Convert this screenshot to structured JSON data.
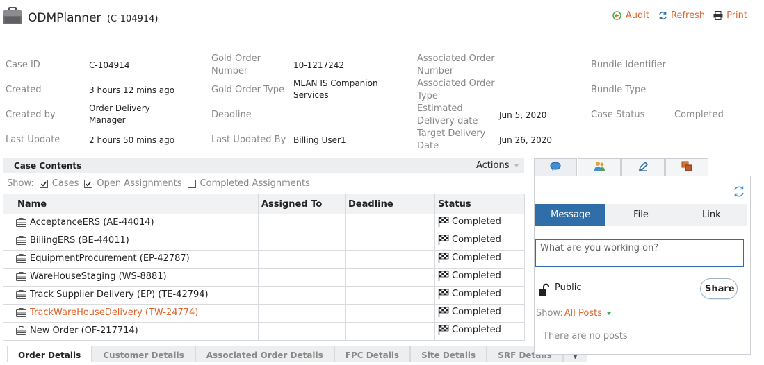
{
  "header": {
    "title": "ODMPlanner",
    "case_ref": "(C-104914)",
    "actions": [
      {
        "label": "Audit",
        "icon": "audit-icon"
      },
      {
        "label": "Refresh",
        "icon": "refresh-icon"
      },
      {
        "label": "Print",
        "icon": "print-icon"
      }
    ]
  },
  "summary": {
    "col1": [
      {
        "label": "Case ID",
        "value": "C-104914"
      },
      {
        "label": "Created",
        "value": "3 hours 12 mins ago"
      },
      {
        "label": "Created by",
        "value": "Order Delivery Manager"
      },
      {
        "label": "Last Update",
        "value": "2 hours 50 mins ago"
      }
    ],
    "col2": [
      {
        "label": "Gold Order Number",
        "value": "10-1217242"
      },
      {
        "label": "Gold Order Type",
        "value": "MLAN IS Companion Services"
      },
      {
        "label": "Deadline",
        "value": ""
      },
      {
        "label": "Last Updated By",
        "value": "Billing User1"
      }
    ],
    "col3": [
      {
        "label": "Associated Order Number",
        "value": ""
      },
      {
        "label": "Associated Order Type",
        "value": ""
      },
      {
        "label": "Estimated Delivery date",
        "value": "Jun 5, 2020"
      },
      {
        "label": "Target Delivery Date",
        "value": "Jun 26, 2020"
      }
    ],
    "col4": [
      {
        "label": "Bundle Identifier",
        "value": ""
      },
      {
        "label": "Bundle Type",
        "value": ""
      },
      {
        "label": "Case Status",
        "value": "Completed"
      },
      {
        "label": "",
        "value": ""
      }
    ]
  },
  "case_contents": {
    "title": "Case Contents",
    "actions_label": "Actions",
    "show_label": "Show:",
    "filters": [
      {
        "label": "Cases",
        "checked": true
      },
      {
        "label": "Open Assignments",
        "checked": true
      },
      {
        "label": "Completed Assignments",
        "checked": false
      }
    ],
    "columns": [
      "Name",
      "Assigned To",
      "Deadline",
      "Status"
    ],
    "rows": [
      {
        "name": "AcceptanceERS (AE-44014)",
        "assigned": "",
        "deadline": "",
        "status": "Completed"
      },
      {
        "name": "BillingERS (BE-44011)",
        "assigned": "",
        "deadline": "",
        "status": "Completed"
      },
      {
        "name": "EquipmentProcurement (EP-42787)",
        "assigned": "",
        "deadline": "",
        "status": "Completed"
      },
      {
        "name": "WareHouseStaging (WS-8881)",
        "assigned": "",
        "deadline": "",
        "status": "Completed"
      },
      {
        "name": "Track Supplier Delivery (EP) (TE-42794)",
        "assigned": "",
        "deadline": "",
        "status": "Completed"
      },
      {
        "name": "TrackWareHouseDelivery (TW-24774)",
        "assigned": "",
        "deadline": "",
        "status": "Completed",
        "highlight": true
      },
      {
        "name": "New Order (OF-217714)",
        "assigned": "",
        "deadline": "",
        "status": "Completed"
      }
    ]
  },
  "bottom_tabs": [
    "Order Details",
    "Customer Details",
    "Associated Order Details",
    "FPC Details",
    "Site Details",
    "SRF Details"
  ],
  "side_panel": {
    "tab_icons": [
      "chat-bubble-icon",
      "users-icon",
      "pencil-icon",
      "documents-icon"
    ],
    "post_types": [
      "Message",
      "File",
      "Link"
    ],
    "input_placeholder": "What are you working on?",
    "visibility": "Public",
    "share_label": "Share",
    "show_label": "Show:",
    "show_value": "All Posts",
    "empty_text": "There are no posts"
  },
  "colors": {
    "accent": "#e0642a",
    "primary": "#2f6ea8",
    "label_grey": "#888888"
  }
}
